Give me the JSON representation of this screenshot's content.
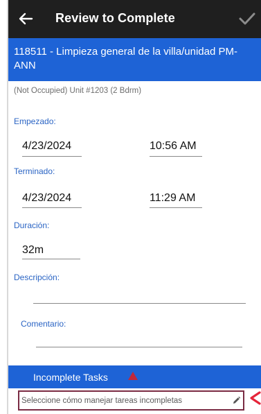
{
  "header": {
    "title": "Review to Complete",
    "back_icon": "arrow-left-icon",
    "confirm_icon": "check-icon",
    "background": "#1f1f1f"
  },
  "job": {
    "title": "118511 - Limpieza general de la villa/unidad PM-ANN",
    "background": "#1e63d6"
  },
  "unit": {
    "description": "(Not Occupied) Unit #1203 (2 Bdrm)"
  },
  "started": {
    "label": "Empezado:",
    "date": "4/23/2024",
    "time": "10:56 AM"
  },
  "finished": {
    "label": "Terminado:",
    "date": "4/23/2024",
    "time": "11:29 AM"
  },
  "duration": {
    "label": "Duración:",
    "value": "32m"
  },
  "description": {
    "label": "Descripción:",
    "value": ""
  },
  "comment": {
    "label": "Comentario:",
    "value": ""
  },
  "incomplete_tasks": {
    "label": "Incomplete Tasks",
    "warning_icon": "warning-triangle-icon",
    "warning_color": "#c0283c",
    "prompt": "Seleccione cómo manejar tareas incompletas",
    "edit_icon": "pencil-icon",
    "highlight_color": "#7a2b43"
  },
  "annotation": {
    "arrow_color": "#e5253a"
  }
}
